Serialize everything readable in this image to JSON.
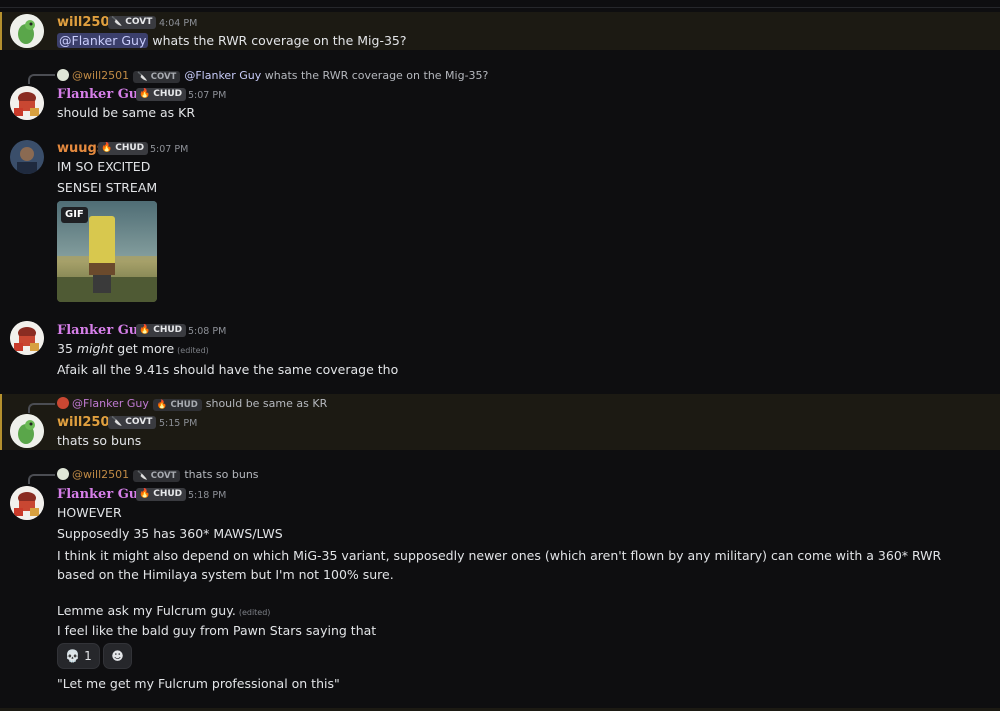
{
  "users": {
    "will": {
      "name": "will2501",
      "badge": "COVT",
      "name_color": "#e0a03f"
    },
    "flanker": {
      "name": "Flanker Guy",
      "badge": "CHUD",
      "name_color": "#d67fe9"
    },
    "wuugs": {
      "name": "wuugs",
      "badge": "CHUD",
      "name_color": "#e58a3f"
    }
  },
  "icons": {
    "covt_badge": "knife-icon",
    "chud_badge": "fire-icon",
    "skull": "skull-icon",
    "add_reaction": "smile-icon"
  },
  "messages": [
    {
      "author": "will2501",
      "badge": "COVT",
      "time": "4:04 PM",
      "mention": "@Flanker Guy",
      "text": "whats the RWR coverage on the Mig-35?"
    },
    {
      "reply_to": {
        "author": "@will2501",
        "badge": "COVT",
        "mention": "@Flanker Guy",
        "text": "whats the RWR coverage on the Mig-35?"
      },
      "author": "Flanker Guy",
      "badge": "CHUD",
      "time": "5:07 PM",
      "text": "should be same as KR"
    },
    {
      "author": "wuugs",
      "badge": "CHUD",
      "time": "5:07 PM",
      "lines": [
        "IM SO EXCITED",
        "SENSEI STREAM"
      ],
      "attachment_tag": "GIF"
    },
    {
      "author": "Flanker Guy",
      "badge": "CHUD",
      "time": "5:08 PM",
      "line1_pre": "35 ",
      "line1_em": "might",
      "line1_post": " get more",
      "edited": "(edited)",
      "line2": "Afaik all the 9.41s should have the same coverage tho"
    },
    {
      "reply_to": {
        "author": "@Flanker Guy",
        "badge": "CHUD",
        "text": "should be same as KR"
      },
      "author": "will2501",
      "badge": "COVT",
      "time": "5:15 PM",
      "text": "thats so buns"
    },
    {
      "reply_to": {
        "author": "@will2501",
        "badge": "COVT",
        "text": "thats so buns"
      },
      "author": "Flanker Guy",
      "badge": "CHUD",
      "time": "5:18 PM",
      "lines": [
        "HOWEVER",
        "Supposedly 35 has 360* MAWS/LWS",
        "I think it might also depend on which MiG-35 variant, supposedly newer ones (which aren't flown by any military) can come with a 360* RWR based on the Himilaya system but I'm not 100% sure.",
        "Lemme ask my Fulcrum guy.",
        "I feel like the bald guy from Pawn Stars saying that",
        "\"Let me get my Fulcrum professional on this\""
      ],
      "edited": "(edited)",
      "reactions": [
        {
          "icon": "skull-icon",
          "count": "1"
        },
        {
          "icon": "smile-icon",
          "count": ""
        }
      ]
    }
  ]
}
